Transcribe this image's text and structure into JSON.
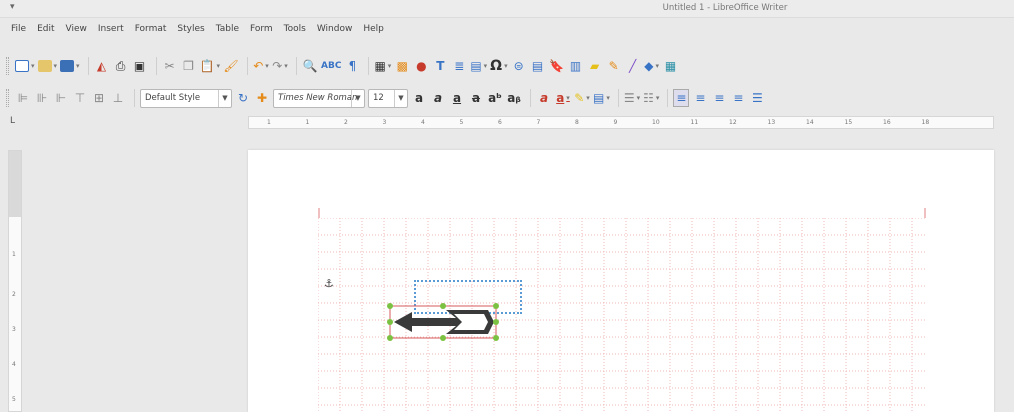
{
  "window": {
    "title": "Untitled 1 - LibreOffice Writer",
    "sysmenu": "▾"
  },
  "menu": [
    "File",
    "Edit",
    "View",
    "Insert",
    "Format",
    "Styles",
    "Table",
    "Form",
    "Tools",
    "Window",
    "Help"
  ],
  "formatting": {
    "paragraph_style": "Default Style",
    "font_name": "Times New Roman",
    "font_size": "12"
  },
  "ruler": {
    "numbers": [
      "1",
      "1",
      "2",
      "3",
      "4",
      "5",
      "6",
      "7",
      "8",
      "9",
      "10",
      "11",
      "12",
      "13",
      "14",
      "15",
      "16",
      "18"
    ],
    "corner_symbol": "L"
  },
  "vertical_ruler": {
    "numbers": [
      "1",
      "2",
      "3",
      "4",
      "5"
    ]
  },
  "colors": {
    "accent_blue": "#3973c6",
    "text_boundaries": "#e8a0a0",
    "selection_handle": "#7cc242",
    "textbox_border": "#5b9bd5",
    "arrow_fill": "#3a3a3a"
  },
  "icons": {
    "toolbar1": [
      "new-document-icon",
      "open-icon",
      "save-icon",
      "export-pdf-icon",
      "print-icon",
      "print-preview-icon",
      "cut-icon",
      "copy-icon",
      "paste-icon",
      "clone-formatting-icon",
      "undo-icon",
      "redo-icon",
      "find-replace-icon",
      "spelling-icon",
      "formatting-marks-icon",
      "insert-table-icon",
      "insert-image-icon",
      "insert-chart-icon",
      "insert-textbox-icon",
      "insert-page-break-icon",
      "insert-field-icon",
      "special-character-icon",
      "hyperlink-icon",
      "footnote-icon",
      "bookmark-icon",
      "cross-reference-icon",
      "comment-icon",
      "track-changes-icon",
      "line-icon",
      "basic-shapes-icon",
      "show-draw-functions-icon"
    ],
    "toolbar2": [
      "align-left-object-icon",
      "anchor-icon",
      "wrap-icon",
      "arrange-icon",
      "font-bold-icon",
      "font-italic-icon",
      "font-underline-icon",
      "font-strikethrough-icon",
      "superscript-icon",
      "subscript-icon",
      "clear-formatting-icon",
      "font-color-icon",
      "highlight-color-icon",
      "paragraph-background-icon",
      "bullets-icon",
      "numbering-icon",
      "align-left-icon",
      "align-center-icon",
      "align-right-icon",
      "justify-icon",
      "line-spacing-icon"
    ]
  }
}
